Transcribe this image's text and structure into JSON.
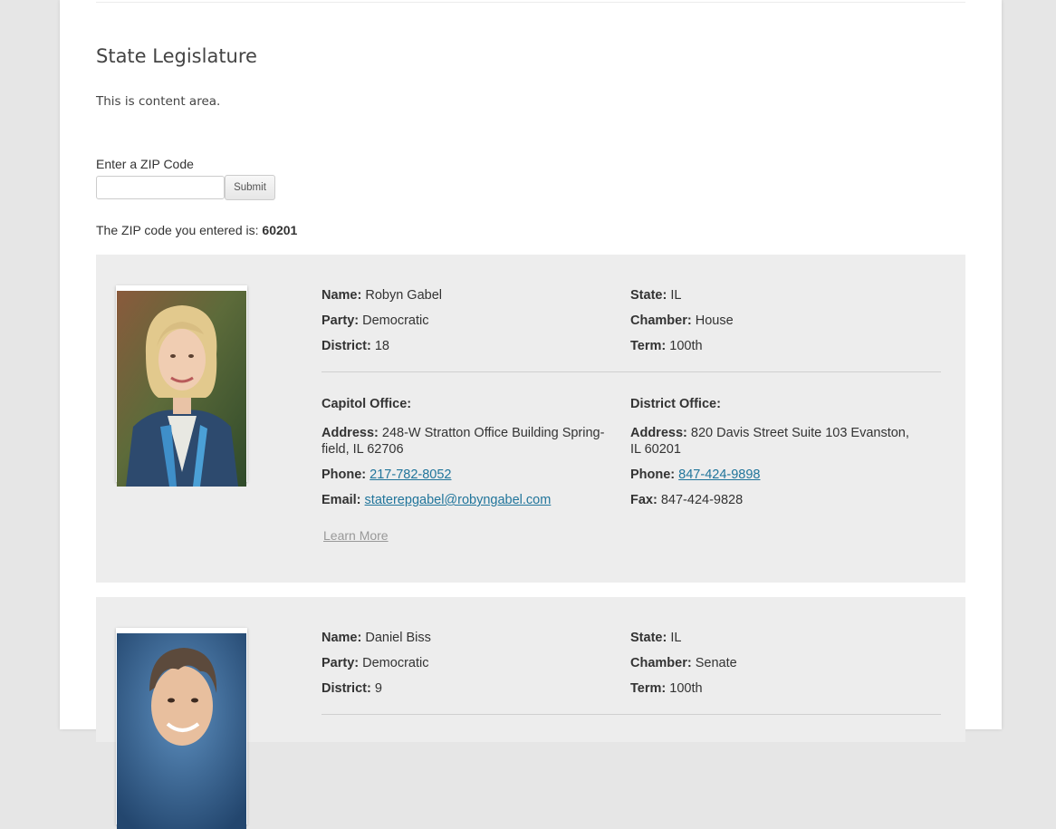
{
  "page": {
    "title": "State Legislature",
    "intro": "This is content area."
  },
  "zip_form": {
    "label": "Enter a ZIP Code",
    "input_value": "",
    "input_placeholder": "",
    "submit_label": "Submit",
    "result_prefix": "The ZIP code you entered is:",
    "result_value": "60201"
  },
  "labels": {
    "name": "Name:",
    "party": "Party:",
    "district": "District:",
    "state": "State:",
    "chamber": "Chamber:",
    "term": "Term:",
    "capitol_office": "Capitol Office:",
    "district_office": "District Office:",
    "address": "Address:",
    "phone": "Phone:",
    "email": "Email:",
    "fax": "Fax:",
    "learn_more": "Learn More"
  },
  "legislators": [
    {
      "name": "Robyn Gabel",
      "party": "Democratic",
      "district": "18",
      "state": "IL",
      "chamber": "House",
      "term": "100th",
      "capitol_address_1": "248-W Stratton Office Building Spring-",
      "capitol_address_2": "field, IL   62706",
      "capitol_phone": "217-782-8052",
      "capitol_email": "staterepgabel@robyngabel.com",
      "district_address_1": "820 Davis Street Suite 103 Evanston,",
      "district_address_2": "IL  60201",
      "district_phone": "847-424-9898",
      "district_fax": "847-424-9828"
    },
    {
      "name": "Daniel Biss",
      "party": "Democratic",
      "district": "9",
      "state": "IL",
      "chamber": "Senate",
      "term": "100th"
    }
  ],
  "colors": {
    "link": "#21759b",
    "card_background": "#ededed",
    "page_background": "#e6e6e6"
  }
}
